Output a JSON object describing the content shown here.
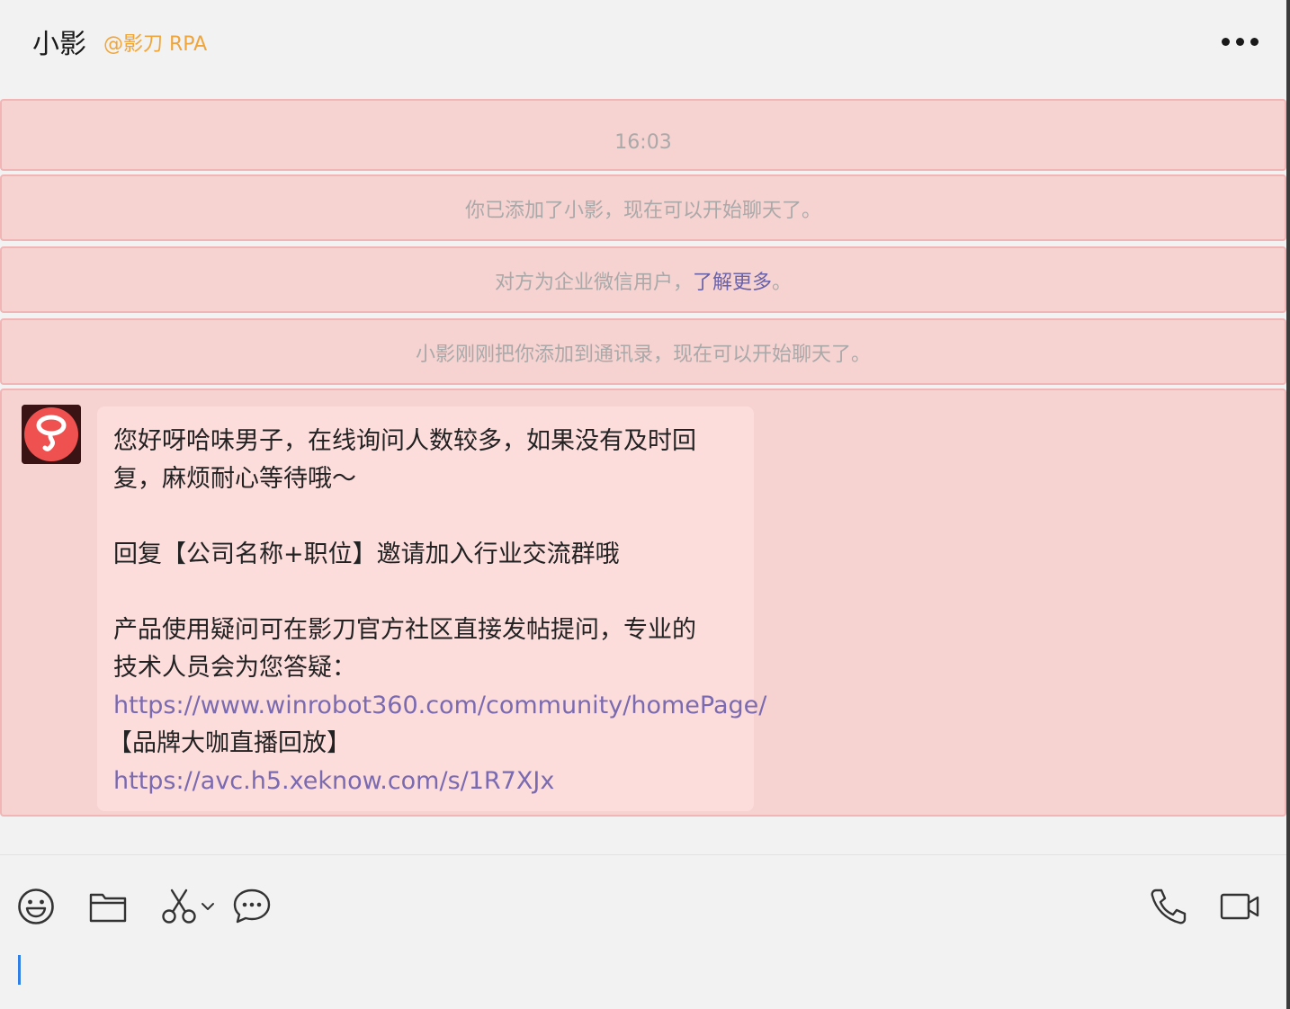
{
  "header": {
    "chat_name": "小影",
    "org_label": "@影刀 RPA",
    "more_icon": "more-horizontal-icon"
  },
  "messages": {
    "timestamp": "16:03",
    "system_added": "你已添加了小影，现在可以开始聊天了。",
    "system_wecom_prefix": "对方为企业微信用户，",
    "system_wecom_link": "了解更多",
    "system_wecom_suffix": "。",
    "system_contacts": "小影刚刚把你添加到通讯录，现在可以开始聊天了。",
    "bubble": {
      "line1": "您好呀哈味男子，在线询问人数较多，如果没有及时回",
      "line2": "复，麻烦耐心等待哦～",
      "line3": "回复【公司名称+职位】邀请加入行业交流群哦",
      "line4": "产品使用疑问可在影刀官方社区直接发帖提问，专业的",
      "line5": "技术人员会为您答疑：",
      "link1": "https://www.winrobot360.com/community/homePage/",
      "line6": "【品牌大咖直播回放】",
      "link2": "https://avc.h5.xeknow.com/s/1R7XJx"
    }
  },
  "toolbar": {
    "emoji_icon": "emoji-icon",
    "folder_icon": "folder-icon",
    "scissors_icon": "scissors-icon",
    "chat_bubble_icon": "chat-bubble-icon",
    "phone_icon": "phone-icon",
    "video_icon": "video-camera-icon"
  },
  "colors": {
    "accent_org": "#f0a53a",
    "link": "#7a6ab0",
    "highlight_row": "#f6d2d1",
    "bubble": "#fddcdc",
    "caret": "#2f7fe6"
  }
}
